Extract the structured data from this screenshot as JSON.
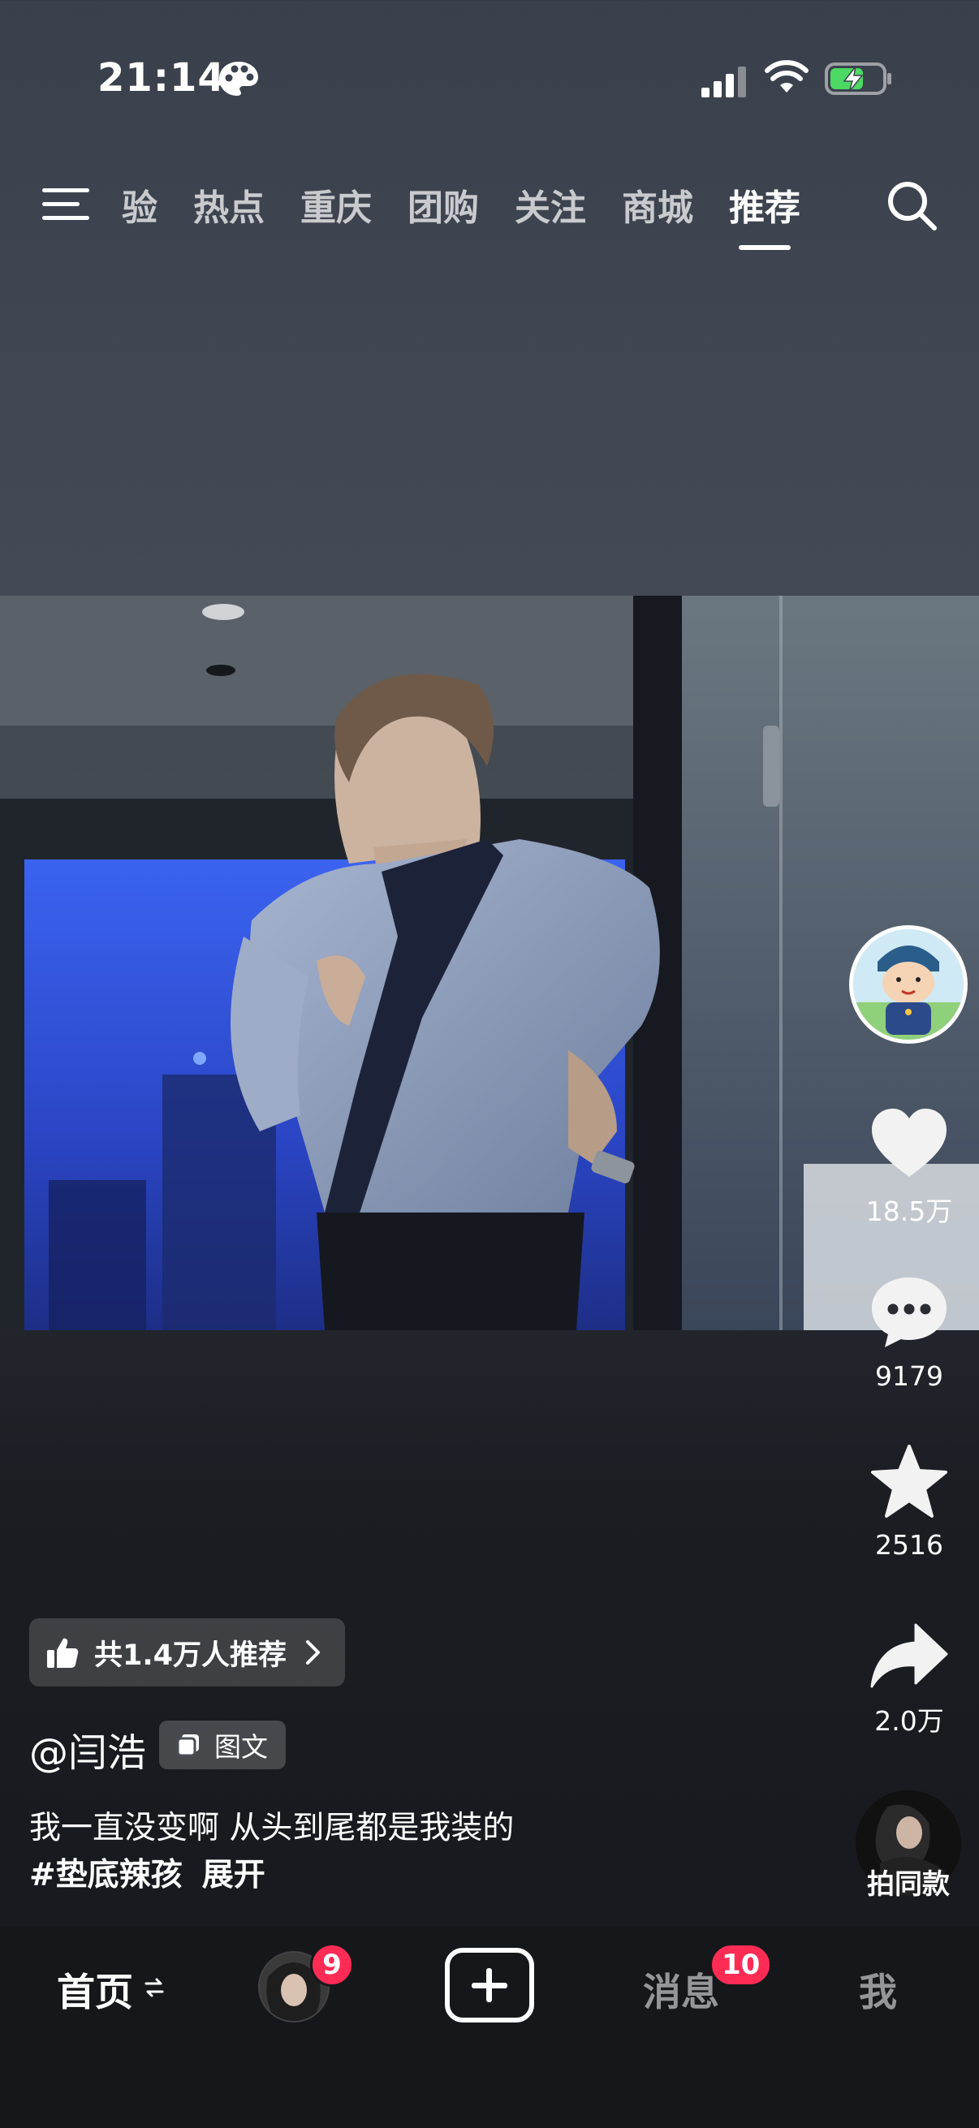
{
  "status_bar": {
    "time": "21:14",
    "battery_color": "#4cd964"
  },
  "top_nav": {
    "tabs": [
      {
        "label": "验"
      },
      {
        "label": "热点"
      },
      {
        "label": "重庆"
      },
      {
        "label": "团购"
      },
      {
        "label": "关注"
      },
      {
        "label": "商城"
      },
      {
        "label": "推荐"
      }
    ],
    "active_tab": "推荐"
  },
  "rail": {
    "likes": "18.5万",
    "comments": "9179",
    "favorites": "2516",
    "shares": "2.0万",
    "same_style_label": "拍同款"
  },
  "post": {
    "recommend_label": "共1.4万人推荐",
    "author": "@闫浩",
    "type_label": "图文",
    "caption_line1": "我一直没变啊 从头到尾都是我装的",
    "hashtag": "#垫底辣孩",
    "expand_label": "展开"
  },
  "tab_bar": {
    "home_label": "首页",
    "friend_badge": "9",
    "message_label": "消息",
    "message_badge": "10",
    "me_label": "我"
  },
  "colors": {
    "accent_badge": "#fe2c55",
    "background": "#17181d"
  }
}
